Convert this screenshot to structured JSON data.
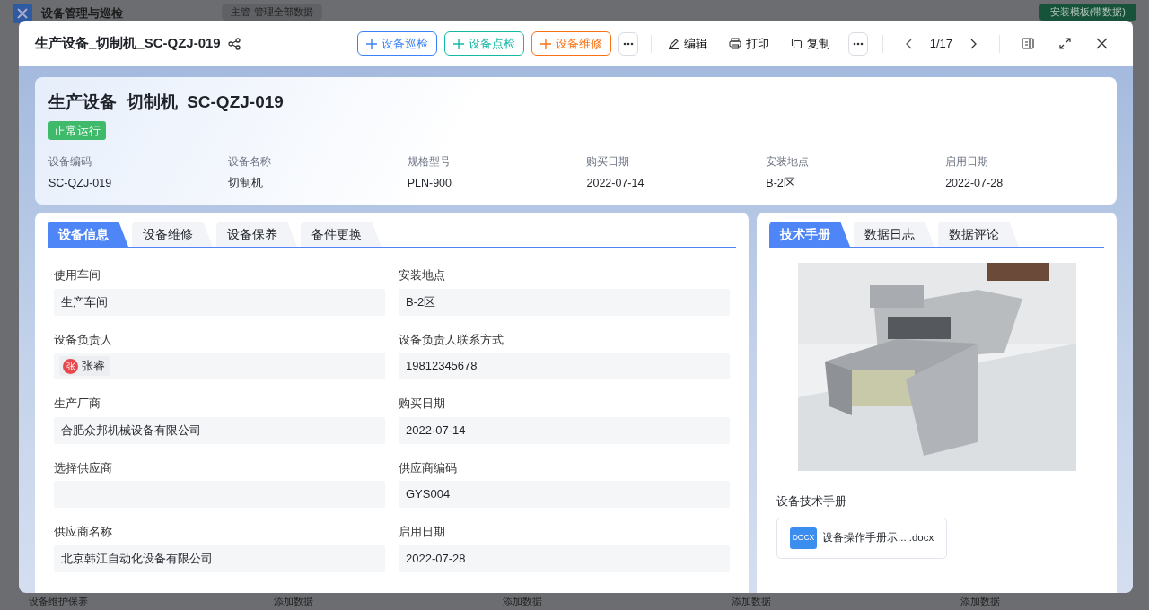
{
  "app": {
    "title": "设备管理与巡检",
    "filter": "主管-管理全部数据",
    "template_button": "安装模板(带数据)",
    "add_buttons": [
      "添加数据",
      "添加数据",
      "添加数据",
      "添加数据"
    ],
    "section": "设备维护保养"
  },
  "modal": {
    "title": "生产设备_切制机_SC-QZJ-019",
    "actions": [
      {
        "label": "设备巡检",
        "color": "#3b82f6"
      },
      {
        "label": "设备点检",
        "color": "#14b8a6"
      },
      {
        "label": "设备维修",
        "color": "#f97316"
      }
    ],
    "tools": [
      {
        "kind": "edit",
        "label": "编辑"
      },
      {
        "kind": "print",
        "label": "打印"
      },
      {
        "kind": "copy",
        "label": "复制"
      }
    ],
    "pager": "1/17"
  },
  "summary": {
    "title": "生产设备_切制机_SC-QZJ-019",
    "status": {
      "label": "正常运行",
      "color": "#3fba6b"
    },
    "fields": [
      {
        "label": "设备编码",
        "value": "SC-QZJ-019"
      },
      {
        "label": "设备名称",
        "value": "切制机"
      },
      {
        "label": "规格型号",
        "value": "PLN-900"
      },
      {
        "label": "购买日期",
        "value": "2022-07-14"
      },
      {
        "label": "安装地点",
        "value": "B-2区"
      },
      {
        "label": "启用日期",
        "value": "2022-07-28"
      }
    ]
  },
  "left_tabs": [
    {
      "label": "设备信息",
      "selected": true
    },
    {
      "label": "设备维修",
      "selected": false
    },
    {
      "label": "设备保养",
      "selected": false
    },
    {
      "label": "备件更换",
      "selected": false
    }
  ],
  "form": [
    {
      "kind": "text",
      "label": "使用车间",
      "value": "生产车间"
    },
    {
      "kind": "text",
      "label": "安装地点",
      "value": "B-2区"
    },
    {
      "kind": "person",
      "label": "设备负责人",
      "value": "张睿",
      "avatar": "张"
    },
    {
      "kind": "text",
      "label": "设备负责人联系方式",
      "value": "19812345678"
    },
    {
      "kind": "text",
      "label": "生产厂商",
      "value": "合肥众邦机械设备有限公司"
    },
    {
      "kind": "text",
      "label": "购买日期",
      "value": "2022-07-14"
    },
    {
      "kind": "empty",
      "label": "选择供应商"
    },
    {
      "kind": "text",
      "label": "供应商编码",
      "value": "GYS004"
    },
    {
      "kind": "text",
      "label": "供应商名称",
      "value": "北京韩江自动化设备有限公司"
    },
    {
      "kind": "text",
      "label": "启用日期",
      "value": "2022-07-28"
    }
  ],
  "right_tabs": [
    {
      "label": "技术手册",
      "selected": true
    },
    {
      "label": "数据日志",
      "selected": false
    },
    {
      "label": "数据评论",
      "selected": false
    }
  ],
  "manual": {
    "label": "设备技术手册",
    "file": {
      "name": "设备操作手册示... .docx",
      "badge": "DOCX"
    }
  }
}
